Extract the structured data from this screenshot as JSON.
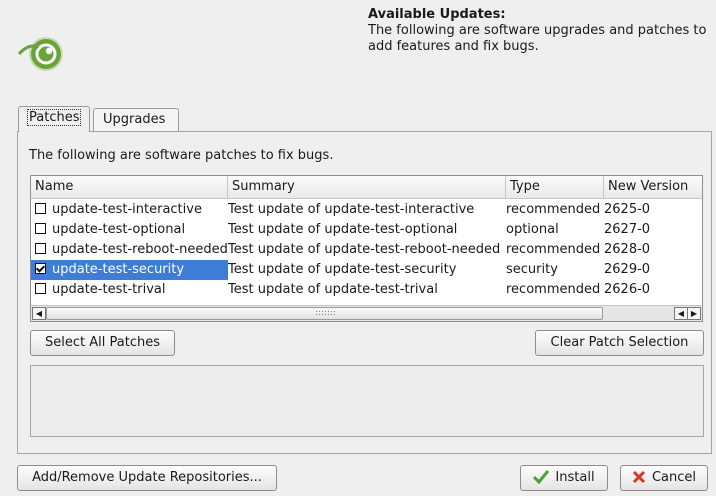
{
  "header": {
    "title": "Available Updates:",
    "line1": "The following are software upgrades and patches to",
    "line2": "add features and fix bugs."
  },
  "tabs": [
    {
      "label": "Patches",
      "active": true
    },
    {
      "label": "Upgrades",
      "active": false
    }
  ],
  "patches": {
    "description": "The following are software patches to fix bugs.",
    "columns": [
      "Name",
      "Summary",
      "Type",
      "New Version"
    ],
    "rows": [
      {
        "name": "update-test-interactive",
        "summary": "Test update of update-test-interactive",
        "type": "recommended",
        "version": "2625-0",
        "checked": false,
        "selected": false
      },
      {
        "name": "update-test-optional",
        "summary": "Test update of update-test-optional",
        "type": "optional",
        "version": "2627-0",
        "checked": false,
        "selected": false
      },
      {
        "name": "update-test-reboot-needed",
        "summary": "Test update of update-test-reboot-needed",
        "type": "recommended",
        "version": "2628-0",
        "checked": false,
        "selected": false
      },
      {
        "name": "update-test-security",
        "summary": "Test update of update-test-security",
        "type": "security",
        "version": "2629-0",
        "checked": true,
        "selected": true
      },
      {
        "name": "update-test-trival",
        "summary": "Test update of update-test-trival",
        "type": "recommended",
        "version": "2626-0",
        "checked": false,
        "selected": false
      }
    ],
    "select_all_label": "Select All Patches",
    "clear_label": "Clear Patch Selection"
  },
  "footer": {
    "repos_label": "Add/Remove Update Repositories...",
    "install_label": "Install",
    "cancel_label": "Cancel"
  },
  "icons": {
    "logo": "opensuse-logo-icon",
    "install": "checkmark-icon",
    "cancel": "cross-icon"
  },
  "colors": {
    "selection": "#3d7dd6",
    "logo": "#6aa33a",
    "install_check": "#4aa02c",
    "cancel_x": "#d8362a"
  }
}
